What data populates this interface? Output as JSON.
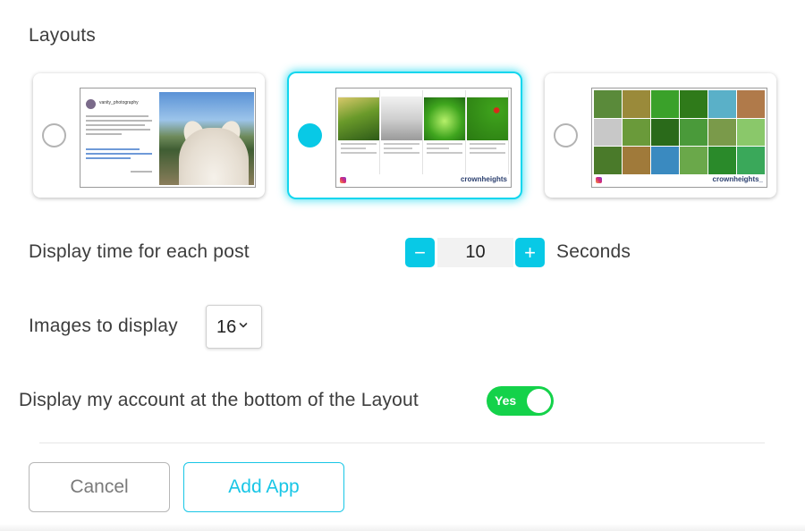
{
  "section_title": "Layouts",
  "layouts": [
    {
      "selected": false,
      "thumb_caption": "vanity_photography"
    },
    {
      "selected": true,
      "thumb_brand": "crownheights"
    },
    {
      "selected": false,
      "thumb_brand": "crownheights_"
    }
  ],
  "display_time": {
    "label": "Display time for each post",
    "minus": "−",
    "value": "10",
    "plus": "+",
    "unit": "Seconds"
  },
  "images_to_display": {
    "label": "Images to display",
    "value": "16"
  },
  "display_account": {
    "label": "Display my account at the bottom of the Layout",
    "toggle_label": "Yes",
    "enabled": true
  },
  "actions": {
    "cancel": "Cancel",
    "add": "Add App"
  },
  "colors": {
    "accent": "#08c9e6",
    "toggle_on": "#14d24a"
  }
}
